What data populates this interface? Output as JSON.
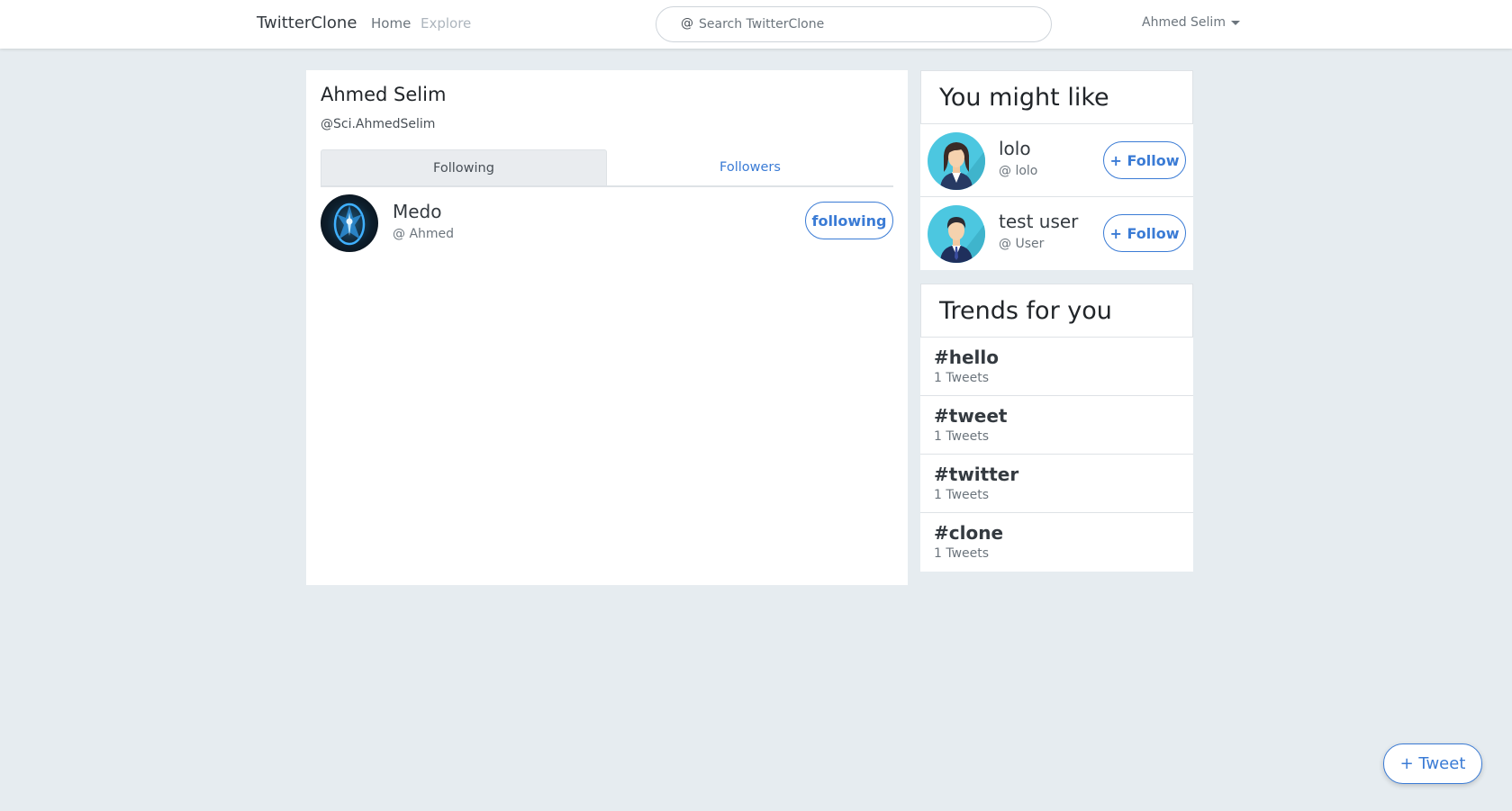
{
  "navbar": {
    "brand": "TwitterClone",
    "home": "Home",
    "explore": "Explore",
    "search_prefix": "@",
    "search_placeholder": "Search TwitterClone",
    "user_name": "Ahmed Selim"
  },
  "profile": {
    "name": "Ahmed Selim",
    "handle": "@Sci.AhmedSelim",
    "tabs": [
      {
        "label": "Following",
        "active": true
      },
      {
        "label": "Followers",
        "active": false
      }
    ],
    "following_list": [
      {
        "name": "Medo",
        "handle": "@ Ahmed",
        "button": "following"
      }
    ]
  },
  "suggestions": {
    "title": "You might like",
    "items": [
      {
        "name": "lolo",
        "handle": "@ lolo",
        "button": "+ Follow",
        "avatar": "woman-avatar-icon"
      },
      {
        "name": "test user",
        "handle": "@ User",
        "button": "+ Follow",
        "avatar": "man-avatar-icon"
      }
    ]
  },
  "trends": {
    "title": "Trends for you",
    "items": [
      {
        "tag": "#hello",
        "count": "1 Tweets"
      },
      {
        "tag": "#tweet",
        "count": "1 Tweets"
      },
      {
        "tag": "#twitter",
        "count": "1 Tweets"
      },
      {
        "tag": "#clone",
        "count": "1 Tweets"
      }
    ]
  },
  "fab": {
    "label": "+ Tweet"
  },
  "colors": {
    "accent": "#3a7bd5",
    "background": "#e6ecf0",
    "avatar_bg": "#4cc7e0"
  }
}
